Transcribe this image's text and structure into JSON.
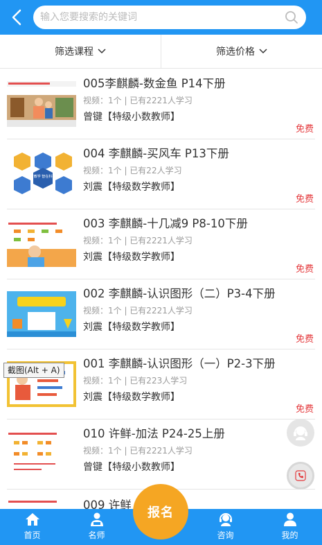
{
  "header": {
    "search_placeholder": "输入您要搜索的关键词"
  },
  "filters": {
    "course_label": "筛选课程",
    "price_label": "筛选价格"
  },
  "courses": [
    {
      "title": "005李麒麟-数金鱼 P14下册",
      "meta": "视频：1个 | 已有2221人学习",
      "teacher": "曾键【特级小数教师】",
      "price": "免费"
    },
    {
      "title": "004 李麒麟-买风车 P13下册",
      "meta": "视频：1个 | 已有22人学习",
      "teacher": "刘震【特级数学教师】",
      "price": "免费"
    },
    {
      "title": "003 李麒麟-十几减9 P8-10下册",
      "meta": "视频：1个 | 已有2221人学习",
      "teacher": "刘震【特级数学教师】",
      "price": "免费"
    },
    {
      "title": "002 李麒麟-认识图形（二）P3-4下册",
      "meta": "视频：1个 | 已有2221人学习",
      "teacher": "刘震【特级数学教师】",
      "price": "免费"
    },
    {
      "title": "001 李麒麟-认识图形（一）P2-3下册",
      "meta": "视频：1个 | 已有223人学习",
      "teacher": "刘震【特级数学教师】",
      "price": "免费"
    },
    {
      "title": "010 许鲜-加法 P24-25上册",
      "meta": "视频：1个 | 已有2221人学习",
      "teacher": "曾键【特级小数教师】",
      "price": ""
    },
    {
      "title": "009 许鲜",
      "meta": "",
      "teacher": "",
      "price": ""
    }
  ],
  "thumbnail_texts": {
    "hex_caption": "新教学 智在科技"
  },
  "tooltip": "截图(Alt + A)",
  "signup_label": "报名",
  "nav": {
    "home": "首页",
    "teachers": "名师",
    "consult": "咨询",
    "mine": "我的"
  },
  "colors": {
    "primary": "#2196f3",
    "free": "#e4393c",
    "signup": "#f5a623"
  }
}
